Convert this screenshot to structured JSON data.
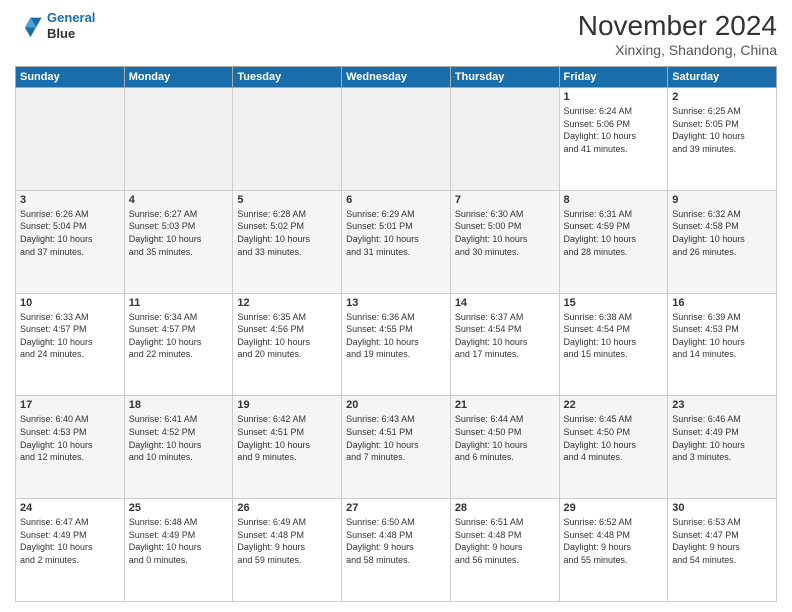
{
  "header": {
    "logo_line1": "General",
    "logo_line2": "Blue",
    "month_title": "November 2024",
    "location": "Xinxing, Shandong, China"
  },
  "weekdays": [
    "Sunday",
    "Monday",
    "Tuesday",
    "Wednesday",
    "Thursday",
    "Friday",
    "Saturday"
  ],
  "weeks": [
    [
      {
        "day": "",
        "info": ""
      },
      {
        "day": "",
        "info": ""
      },
      {
        "day": "",
        "info": ""
      },
      {
        "day": "",
        "info": ""
      },
      {
        "day": "",
        "info": ""
      },
      {
        "day": "1",
        "info": "Sunrise: 6:24 AM\nSunset: 5:06 PM\nDaylight: 10 hours\nand 41 minutes."
      },
      {
        "day": "2",
        "info": "Sunrise: 6:25 AM\nSunset: 5:05 PM\nDaylight: 10 hours\nand 39 minutes."
      }
    ],
    [
      {
        "day": "3",
        "info": "Sunrise: 6:26 AM\nSunset: 5:04 PM\nDaylight: 10 hours\nand 37 minutes."
      },
      {
        "day": "4",
        "info": "Sunrise: 6:27 AM\nSunset: 5:03 PM\nDaylight: 10 hours\nand 35 minutes."
      },
      {
        "day": "5",
        "info": "Sunrise: 6:28 AM\nSunset: 5:02 PM\nDaylight: 10 hours\nand 33 minutes."
      },
      {
        "day": "6",
        "info": "Sunrise: 6:29 AM\nSunset: 5:01 PM\nDaylight: 10 hours\nand 31 minutes."
      },
      {
        "day": "7",
        "info": "Sunrise: 6:30 AM\nSunset: 5:00 PM\nDaylight: 10 hours\nand 30 minutes."
      },
      {
        "day": "8",
        "info": "Sunrise: 6:31 AM\nSunset: 4:59 PM\nDaylight: 10 hours\nand 28 minutes."
      },
      {
        "day": "9",
        "info": "Sunrise: 6:32 AM\nSunset: 4:58 PM\nDaylight: 10 hours\nand 26 minutes."
      }
    ],
    [
      {
        "day": "10",
        "info": "Sunrise: 6:33 AM\nSunset: 4:57 PM\nDaylight: 10 hours\nand 24 minutes."
      },
      {
        "day": "11",
        "info": "Sunrise: 6:34 AM\nSunset: 4:57 PM\nDaylight: 10 hours\nand 22 minutes."
      },
      {
        "day": "12",
        "info": "Sunrise: 6:35 AM\nSunset: 4:56 PM\nDaylight: 10 hours\nand 20 minutes."
      },
      {
        "day": "13",
        "info": "Sunrise: 6:36 AM\nSunset: 4:55 PM\nDaylight: 10 hours\nand 19 minutes."
      },
      {
        "day": "14",
        "info": "Sunrise: 6:37 AM\nSunset: 4:54 PM\nDaylight: 10 hours\nand 17 minutes."
      },
      {
        "day": "15",
        "info": "Sunrise: 6:38 AM\nSunset: 4:54 PM\nDaylight: 10 hours\nand 15 minutes."
      },
      {
        "day": "16",
        "info": "Sunrise: 6:39 AM\nSunset: 4:53 PM\nDaylight: 10 hours\nand 14 minutes."
      }
    ],
    [
      {
        "day": "17",
        "info": "Sunrise: 6:40 AM\nSunset: 4:53 PM\nDaylight: 10 hours\nand 12 minutes."
      },
      {
        "day": "18",
        "info": "Sunrise: 6:41 AM\nSunset: 4:52 PM\nDaylight: 10 hours\nand 10 minutes."
      },
      {
        "day": "19",
        "info": "Sunrise: 6:42 AM\nSunset: 4:51 PM\nDaylight: 10 hours\nand 9 minutes."
      },
      {
        "day": "20",
        "info": "Sunrise: 6:43 AM\nSunset: 4:51 PM\nDaylight: 10 hours\nand 7 minutes."
      },
      {
        "day": "21",
        "info": "Sunrise: 6:44 AM\nSunset: 4:50 PM\nDaylight: 10 hours\nand 6 minutes."
      },
      {
        "day": "22",
        "info": "Sunrise: 6:45 AM\nSunset: 4:50 PM\nDaylight: 10 hours\nand 4 minutes."
      },
      {
        "day": "23",
        "info": "Sunrise: 6:46 AM\nSunset: 4:49 PM\nDaylight: 10 hours\nand 3 minutes."
      }
    ],
    [
      {
        "day": "24",
        "info": "Sunrise: 6:47 AM\nSunset: 4:49 PM\nDaylight: 10 hours\nand 2 minutes."
      },
      {
        "day": "25",
        "info": "Sunrise: 6:48 AM\nSunset: 4:49 PM\nDaylight: 10 hours\nand 0 minutes."
      },
      {
        "day": "26",
        "info": "Sunrise: 6:49 AM\nSunset: 4:48 PM\nDaylight: 9 hours\nand 59 minutes."
      },
      {
        "day": "27",
        "info": "Sunrise: 6:50 AM\nSunset: 4:48 PM\nDaylight: 9 hours\nand 58 minutes."
      },
      {
        "day": "28",
        "info": "Sunrise: 6:51 AM\nSunset: 4:48 PM\nDaylight: 9 hours\nand 56 minutes."
      },
      {
        "day": "29",
        "info": "Sunrise: 6:52 AM\nSunset: 4:48 PM\nDaylight: 9 hours\nand 55 minutes."
      },
      {
        "day": "30",
        "info": "Sunrise: 6:53 AM\nSunset: 4:47 PM\nDaylight: 9 hours\nand 54 minutes."
      }
    ]
  ]
}
